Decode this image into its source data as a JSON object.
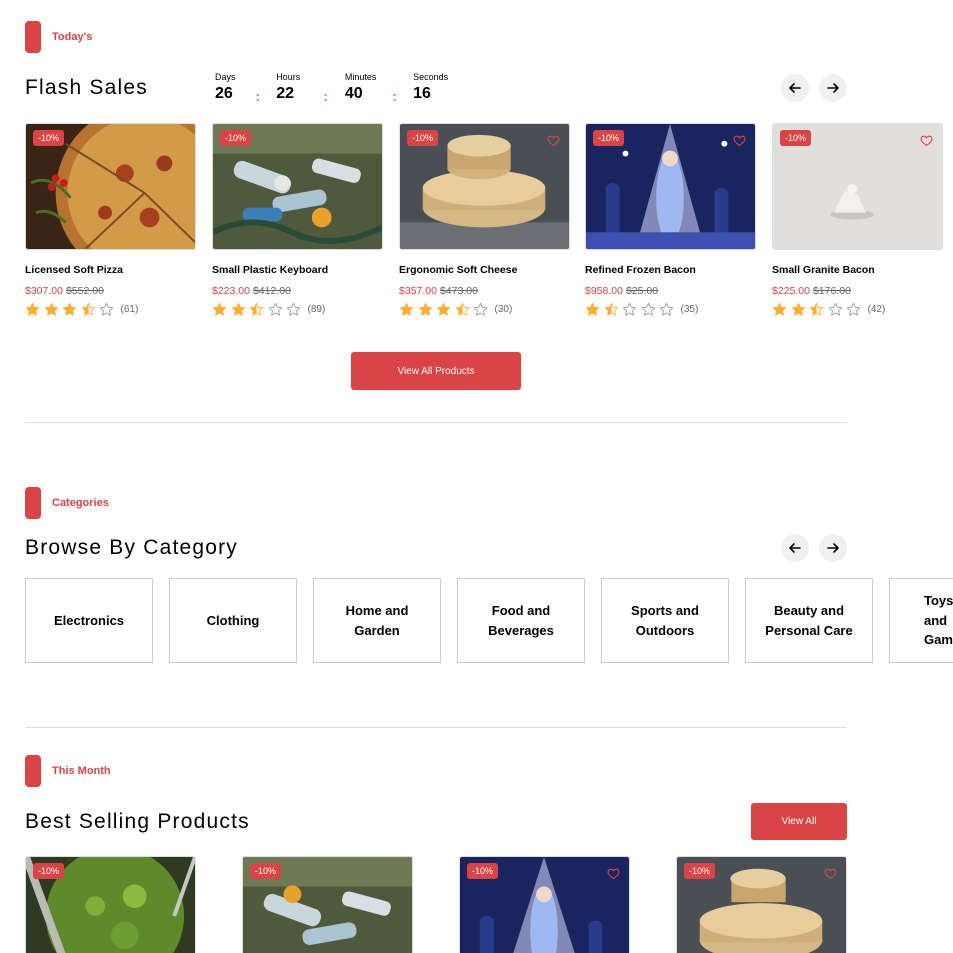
{
  "flash": {
    "tag": "Today's",
    "title": "Flash Sales",
    "countdown": [
      {
        "label": "Days",
        "value": "26"
      },
      {
        "label": "Hours",
        "value": "22"
      },
      {
        "label": "Minutes",
        "value": "40"
      },
      {
        "label": "Seconds",
        "value": "16"
      }
    ],
    "colon": ":",
    "view_all": "View All Products",
    "products": [
      {
        "name": "Licensed Soft Pizza",
        "price": "$307.00",
        "old_price": "$552.00",
        "discount": "-10%",
        "rating": 3.5,
        "reviews": "(61)",
        "image": "pizza"
      },
      {
        "name": "Small Plastic Keyboard",
        "price": "$223.00",
        "old_price": "$412.00",
        "discount": "-10%",
        "rating": 2.5,
        "reviews": "(89)",
        "image": "plastic-waste"
      },
      {
        "name": "Ergonomic Soft Cheese",
        "price": "$357.00",
        "old_price": "$473.00",
        "discount": "-10%",
        "rating": 3.5,
        "reviews": "(30)",
        "image": "cheese"
      },
      {
        "name": "Refined Frozen Bacon",
        "price": "$958.00",
        "old_price": "$25.00",
        "discount": "-10%",
        "rating": 1.5,
        "reviews": "(35)",
        "image": "frozen-figurines"
      },
      {
        "name": "Small Granite Bacon",
        "price": "$225.00",
        "old_price": "$176.00",
        "discount": "-10%",
        "rating": 2.5,
        "reviews": "(42)",
        "image": "figurine"
      }
    ]
  },
  "categories": {
    "tag": "Categories",
    "title": "Browse By Category",
    "items": [
      "Electronics",
      "Clothing",
      "Home and Garden",
      "Food and Beverages",
      "Sports and Outdoors",
      "Beauty and Personal Care",
      "Toys and Games"
    ]
  },
  "best": {
    "tag": "This Month",
    "title": "Best Selling Products",
    "view_all": "View All",
    "products": [
      {
        "discount": "-10%",
        "image": "greens"
      },
      {
        "discount": "-10%",
        "image": "plastic-waste"
      },
      {
        "discount": "-10%",
        "image": "frozen-figurines"
      },
      {
        "discount": "-10%",
        "image": "cheese"
      }
    ]
  },
  "colors": {
    "accent": "#db4444",
    "star": "#ffad33"
  },
  "icons": [
    "arrow-left-icon",
    "arrow-right-icon",
    "heart-icon",
    "star-icon"
  ]
}
